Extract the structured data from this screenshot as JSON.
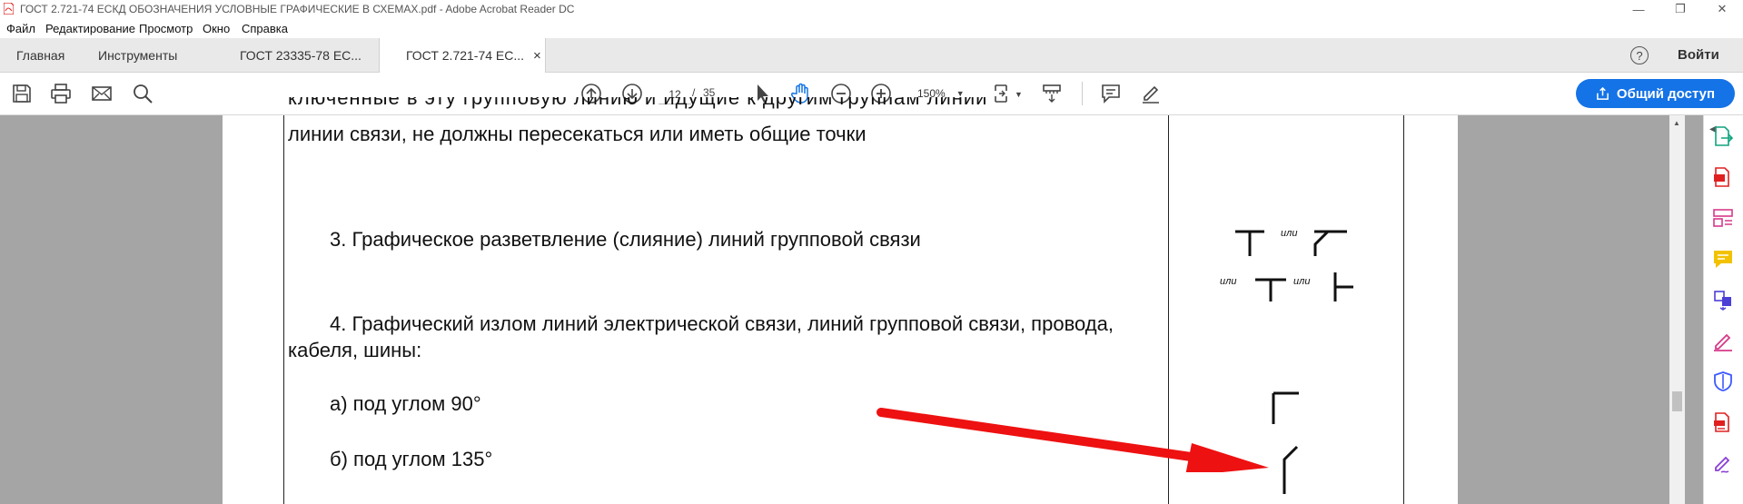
{
  "window": {
    "title": "ГОСТ 2.721-74 ЕСКД ОБОЗНАЧЕНИЯ УСЛОВНЫЕ ГРАФИЧЕСКИЕ В СХЕМАХ.pdf - Adobe Acrobat Reader DC",
    "minimize": "—",
    "restore": "❐",
    "close": "✕"
  },
  "menu": {
    "file": "Файл",
    "edit": "Редактирование",
    "view": "Просмотр",
    "window": "Окно",
    "help": "Справка"
  },
  "tabs": {
    "home": "Главная",
    "tools": "Инструменты",
    "doc1": "ГОСТ 23335-78 ЕС...",
    "doc2": "ГОСТ 2.721-74 ЕС...",
    "close_glyph": "×",
    "help": "?",
    "signin": "Войти"
  },
  "toolbar": {
    "page_current": "12",
    "page_separator": "/",
    "page_total": "35",
    "zoom": "150%",
    "share_button": "Общий доступ"
  },
  "document": {
    "line_a": "линии связи, не должны пересекаться или иметь общие точки",
    "item3": "3. Графическое разветвление (слияние) линий групповой связи",
    "item4_l1": "4. Графический излом линий электрической связи, линий групповой связи, провода,",
    "item4_l2": "кабеля, шины:",
    "item4a": "а) под углом 90°",
    "item4b": "б) под углом 135°",
    "ili": "или"
  },
  "colors": {
    "accent": "#1473e6",
    "arrow": "#ee1111",
    "viewer_bg": "#a5a5a5"
  },
  "icons": {
    "save": "save-icon",
    "print": "print-icon",
    "email": "email-icon",
    "search": "search-icon"
  }
}
